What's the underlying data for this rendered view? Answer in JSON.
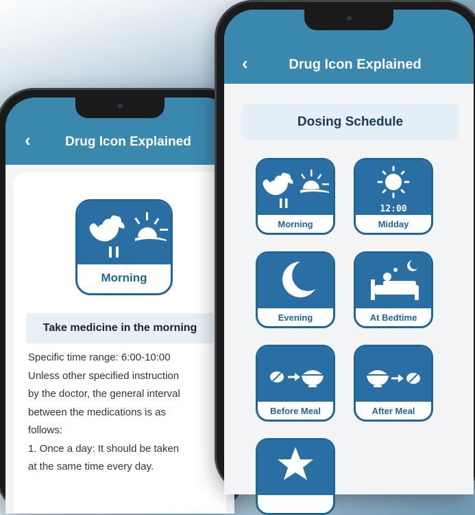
{
  "left_screen": {
    "header": {
      "back_icon": "chevron-left-icon",
      "title": "Drug Icon Explained"
    },
    "icon": {
      "label": "Morning",
      "icon": "rooster-sunrise-icon"
    },
    "heading": "Take medicine in the morning",
    "lines": [
      "Specific time range: 6:00-10:00",
      "Unless other specified instruction",
      "by the doctor, the general interval",
      "between the medications is as",
      "follows:",
      "1. Once a day: It should be taken",
      "at the same time every day."
    ]
  },
  "right_screen": {
    "header": {
      "back_icon": "chevron-left-icon",
      "title": "Drug Icon Explained"
    },
    "section_title": "Dosing Schedule",
    "tiles": [
      {
        "label": "Morning",
        "icon": "rooster-sunrise-icon"
      },
      {
        "label": "Midday",
        "icon": "sun-clock-icon",
        "time": "12:00"
      },
      {
        "label": "Evening",
        "icon": "moon-icon"
      },
      {
        "label": "At Bedtime",
        "icon": "bed-sleep-icon"
      },
      {
        "label": "Before Meal",
        "icon": "pill-before-bowl-icon"
      },
      {
        "label": "After Meal",
        "icon": "bowl-before-pill-icon"
      },
      {
        "label": "",
        "icon": "star-icon"
      }
    ]
  },
  "colors": {
    "header": "#3a88ad",
    "icon_fill": "#2a6fa3",
    "icon_border": "#1f6597"
  }
}
